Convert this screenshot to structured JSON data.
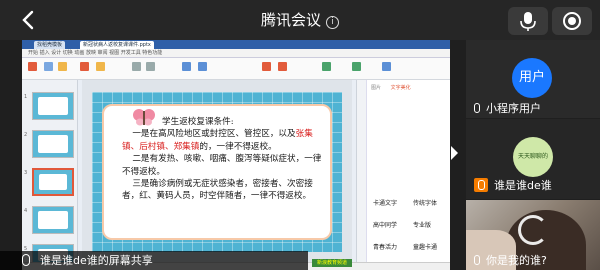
{
  "header": {
    "title": "腾讯会议",
    "info_icon": "info-icon",
    "back_icon": "back-arrow-icon",
    "mic_icon": "microphone-icon",
    "record_icon": "record-icon"
  },
  "share": {
    "tabs": [
      "找稻壳模板",
      "新冠状病人返校复课课件.pptx"
    ],
    "menu": "开始 插入 设计 切换 动画 放映 审阅 视图 开发工具 特色功能",
    "label": "谁是谁de谁的屏幕共享",
    "panel_tabs": [
      "图片",
      "文字美化"
    ],
    "font_samples": [
      "卡通文字",
      "传统字体",
      "高中同学",
      "专业版",
      "青春活力",
      "童趣卡通"
    ],
    "watermark": "新浪教育频道",
    "slide": {
      "heading": "学生返校复课条件:",
      "p1_prefix": "一是在高风险地区或封控区、管控区，以及",
      "p1_red": "张集镇、后村镇、郑集镇",
      "p1_suffix": "的，一律不得返校。",
      "p2": "二是有发热、咳嗽、咽痛、腹泻等疑似症状，一律不得返校。",
      "p3": "三是确诊病例或无症状感染者，密接者、次密接者，红、黄码人员，时空伴随者，一律不得返校。"
    }
  },
  "participants": [
    {
      "avatar_text": "用户",
      "name": "小程序用户",
      "color": "#1a78ff"
    },
    {
      "avatar_text": "天天聊聊的",
      "name": "谁是谁de谁",
      "color": "#cfe8a8"
    },
    {
      "name": "你是我的谁?"
    }
  ]
}
